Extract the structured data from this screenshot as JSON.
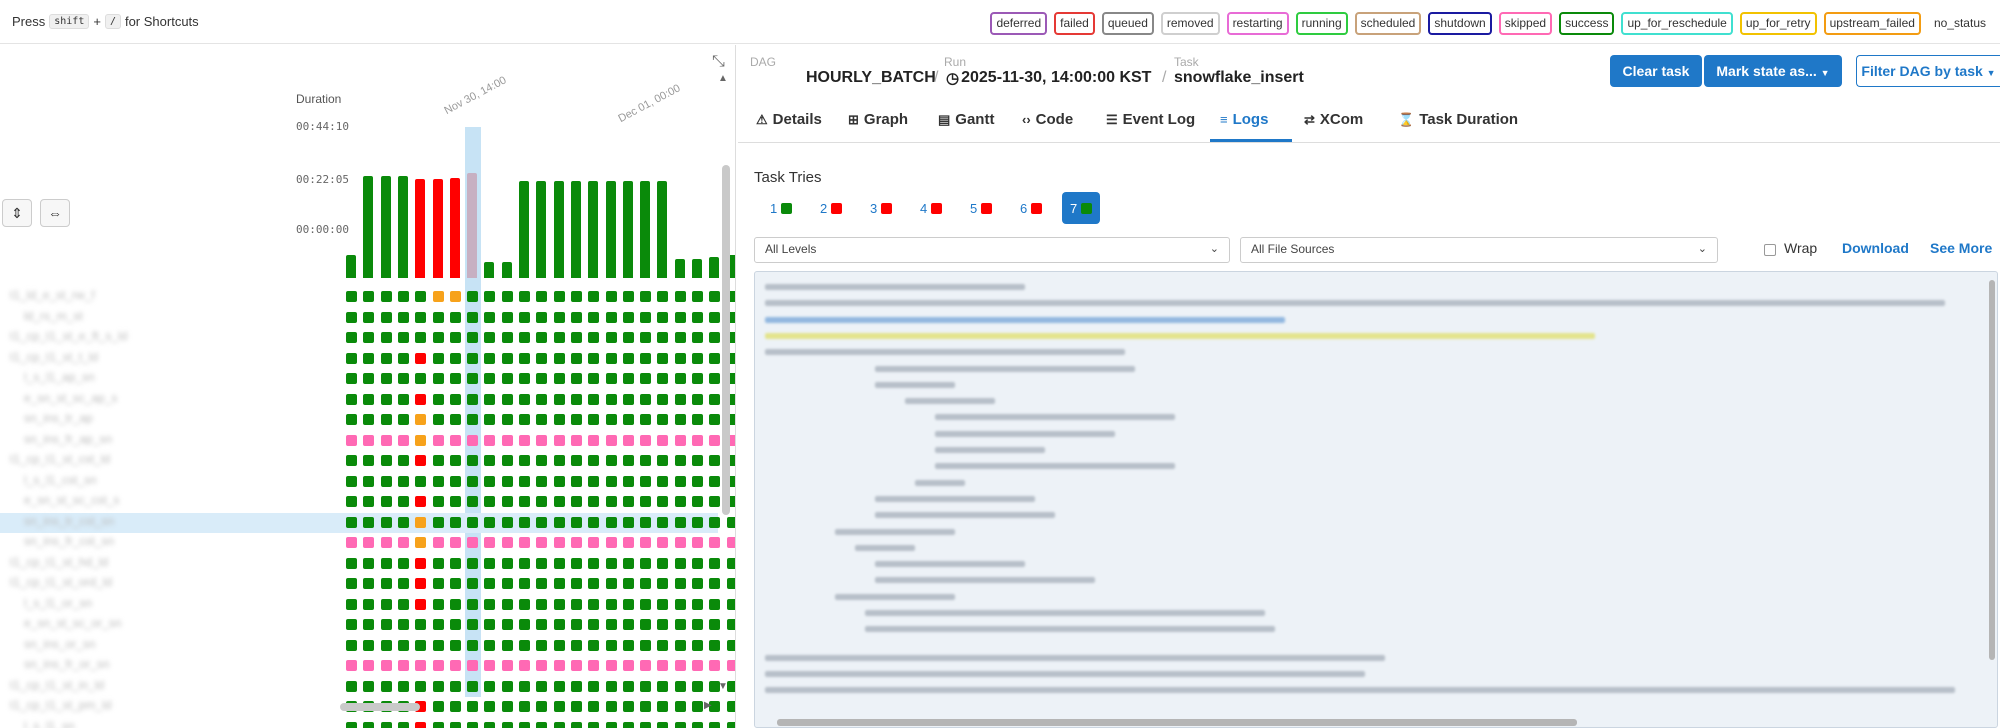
{
  "topbar": {
    "press": "Press",
    "key_shift": "shift",
    "plus": "+",
    "key_slash": "/",
    "for_shortcuts": "for Shortcuts"
  },
  "legend": [
    {
      "label": "deferred",
      "color": "#9b59b6"
    },
    {
      "label": "failed",
      "color": "#e53935"
    },
    {
      "label": "queued",
      "color": "#888888"
    },
    {
      "label": "removed",
      "color": "#cfcfcf"
    },
    {
      "label": "restarting",
      "color": "#e86bd6"
    },
    {
      "label": "running",
      "color": "#2ecc40"
    },
    {
      "label": "scheduled",
      "color": "#c8a27a"
    },
    {
      "label": "shutdown",
      "color": "#1a1aa0"
    },
    {
      "label": "skipped",
      "color": "#ff69b4"
    },
    {
      "label": "success",
      "color": "#0a8a0a"
    },
    {
      "label": "up_for_reschedule",
      "color": "#40e0d0"
    },
    {
      "label": "up_for_retry",
      "color": "#f2c200"
    },
    {
      "label": "upstream_failed",
      "color": "#f39c12"
    },
    {
      "label": "no_status",
      "color": ""
    }
  ],
  "grid": {
    "duration_label": "Duration",
    "yticks": [
      "00:44:10",
      "00:22:05",
      "00:00:00"
    ],
    "date_labels": [
      "Nov 30, 14:00",
      "Dec 01, 00:00"
    ],
    "bar_fractions": [
      0.22,
      0.97,
      0.97,
      0.97,
      0.94,
      0.94,
      0.95,
      1.0,
      0.15,
      0.15,
      0.92,
      0.92,
      0.92,
      0.92,
      0.92,
      0.92,
      0.92,
      0.92,
      0.92,
      0.18,
      0.18,
      0.2,
      0.22,
      0.24,
      0.26,
      0.22
    ],
    "bar_states": [
      "success",
      "success",
      "success",
      "success",
      "failed",
      "failed",
      "failed",
      "failed",
      "success",
      "success",
      "success",
      "success",
      "success",
      "success",
      "success",
      "success",
      "success",
      "success",
      "success",
      "success",
      "success",
      "success",
      "success",
      "success",
      "success",
      "success"
    ],
    "selected_column": 8,
    "selected_row": 11,
    "rows": [
      "t1_ld_e_st_rw_f",
      "ld_rs_m_st",
      "t1_cp_t1_st_e_ft_s_ld",
      "t1_cp_t1_st_t_ld",
      "l_s_l1_ap_sn",
      "e_sn_st_sc_ap_s",
      "sn_ins_tr_ap",
      "sn_ins_fr_ap_sn",
      "t1_cp_t1_st_cst_ld",
      "l_s_l1_cst_sn",
      "e_sn_st_sc_cst_s",
      "sn_ins_tr_cst_sn",
      "sn_ins_fr_cst_sn",
      "t1_cp_t1_st_hd_ld",
      "t1_cp_t1_st_ord_ld",
      "l_s_l1_or_sn",
      "e_sn_st_sc_or_sn",
      "sn_ins_or_sn",
      "sn_ins_fr_or_sn",
      "t1_cp_t1_st_in_ld",
      "t1_cp_t1_st_pm_ld",
      "l_s_l1_sn"
    ],
    "row_states": [
      "gggggoogggggggggggggggggggg",
      "gggggggggggggggggggggggggg",
      "gggggggggggggggggggggggggg",
      "ggggfgggggggggggggggggggggg",
      "gggggggggggggggggggggggggg",
      "ggggfgggggggggggggggggggggg",
      "ggggogggggggggggggggggggggg",
      "ppppoppppppppppppppppppppp",
      "ggggfgggggggggggggggggggggg",
      "gggggggggggggggggggggggggg",
      "ggggfgggggggggggggggggggggg",
      "ggggogggggggggggggggggggggg",
      "ppppoppppppppppppppppppppp",
      "ggggfgggggggggggggggggggggg",
      "ggggfgggggggggggggggggggggg",
      "ggggfgggggggggggggggggggggg",
      "gggggggggggggggggggggggggg",
      "gggggggggggggggggggggggggg",
      "pppppppppppppppppppppppppp",
      "gggggggggggggggggggggggggg",
      "ggggfgggggggggggggggggggggg",
      "ggggfgggggggggggggggggggggg"
    ]
  },
  "breadcrumb": {
    "dag_label": "DAG",
    "dag_value": "HOURLY_BATCH",
    "run_label": "Run",
    "run_value": "2025-11-30, 14:00:00 KST",
    "task_label": "Task",
    "task_value": "snowflake_insert",
    "separator": "/"
  },
  "actions": {
    "clear_task": "Clear task",
    "mark_state": "Mark state as...",
    "filter_dag": "Filter DAG by task"
  },
  "tabs": [
    {
      "label": "Details",
      "icon": "warning-icon"
    },
    {
      "label": "Graph",
      "icon": "graph-icon"
    },
    {
      "label": "Gantt",
      "icon": "gantt-icon"
    },
    {
      "label": "Code",
      "icon": "code-icon"
    },
    {
      "label": "Event Log",
      "icon": "event-log-icon"
    },
    {
      "label": "Logs",
      "icon": "list-icon"
    },
    {
      "label": "XCom",
      "icon": "swap-icon"
    },
    {
      "label": "Task Duration",
      "icon": "hourglass-icon"
    }
  ],
  "active_tab": "Logs",
  "tries": {
    "heading": "Task Tries",
    "items": [
      {
        "n": "1",
        "state": "success"
      },
      {
        "n": "2",
        "state": "failed"
      },
      {
        "n": "3",
        "state": "failed"
      },
      {
        "n": "4",
        "state": "failed"
      },
      {
        "n": "5",
        "state": "failed"
      },
      {
        "n": "6",
        "state": "failed"
      },
      {
        "n": "7",
        "state": "success"
      }
    ],
    "active": "7"
  },
  "filters": {
    "levels": "All Levels",
    "sources": "All File Sources",
    "wrap": "Wrap",
    "download": "Download",
    "see_more": "See More"
  },
  "colors": {
    "success": "#0a8a0a",
    "failed": "#ff0000",
    "upstream_failed": "#f7a21b",
    "skipped": "#ff69b4",
    "accent": "#1f78c8"
  }
}
